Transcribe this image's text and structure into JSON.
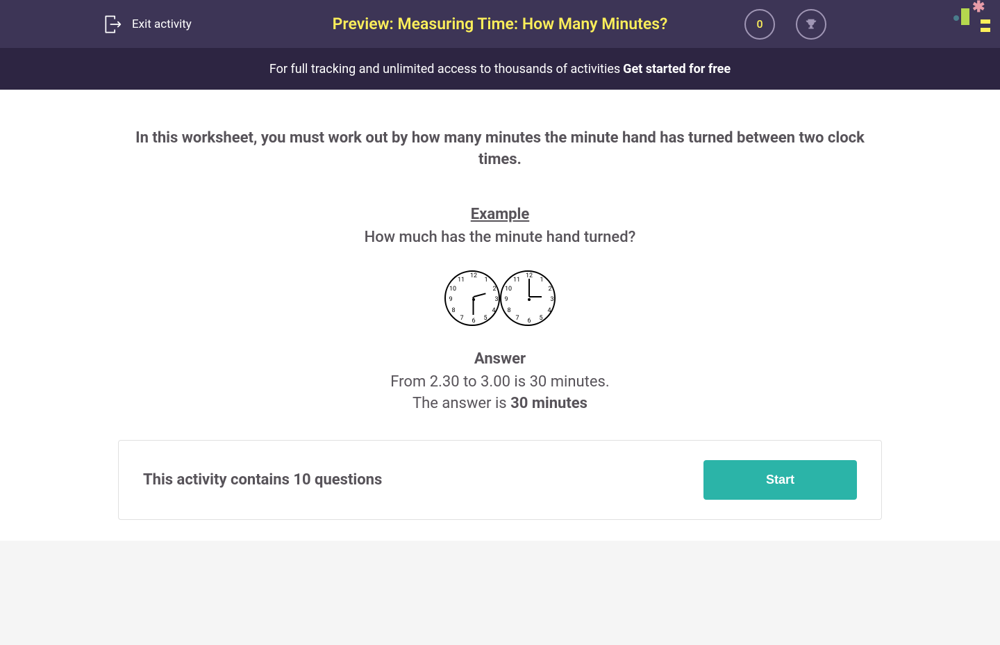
{
  "header": {
    "exit_label": "Exit activity",
    "title": "Preview: Measuring Time: How Many Minutes?",
    "points": "0"
  },
  "promo": {
    "text": "For full tracking and unlimited access to thousands of activities ",
    "link_text": "Get started for free"
  },
  "content": {
    "intro": "In this worksheet, you must work out by how many minutes the minute hand has turned between two clock times.",
    "example_label": "Example",
    "example_question": "How much has the minute hand turned?",
    "clocks": [
      {
        "hour_angle": 75,
        "minute_angle": 180,
        "time_desc": "2:30"
      },
      {
        "hour_angle": 90,
        "minute_angle": 0,
        "time_desc": "3:00"
      }
    ],
    "answer_label": "Answer",
    "answer_line1": "From 2.30 to 3.00 is 30 minutes.",
    "answer_line2_prefix": "The answer is ",
    "answer_line2_bold": "30 minutes"
  },
  "activity": {
    "question_count_text": "This activity contains 10 questions",
    "start_label": "Start"
  }
}
